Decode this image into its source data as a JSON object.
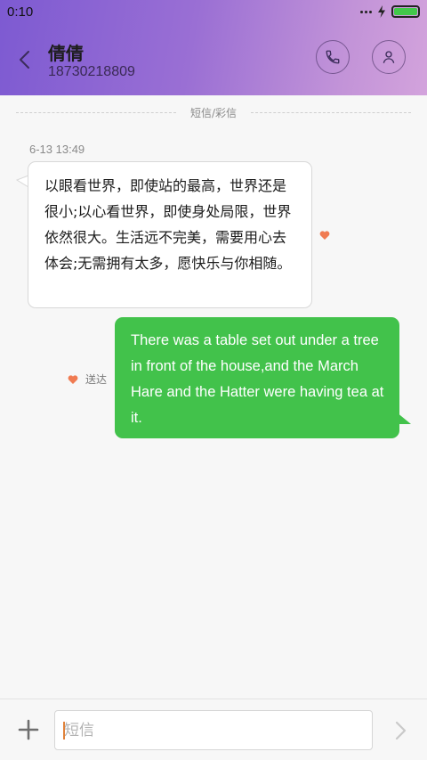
{
  "status_bar": {
    "time": "0:10"
  },
  "header": {
    "contact_name": "倩倩",
    "contact_number": "18730218809"
  },
  "thread": {
    "divider_label": "短信/彩信",
    "timestamp": "6-13 13:49",
    "incoming_message": "以眼看世界，即使站的最高，世界还是很小;以心看世界，即使身处局限，世界依然很大。生活远不完美，需要用心去体会;无需拥有太多，愿快乐与你相随。",
    "outgoing_message": "There was a table set out under a tree in front of the house,and the March Hare and the Hatter were having tea at it.",
    "delivery_status": "送达"
  },
  "composer": {
    "placeholder": "短信",
    "value": ""
  },
  "colors": {
    "header_gradient_start": "#7d5ad2",
    "header_gradient_end": "#d3a3dc",
    "outgoing_bubble": "#42c24b",
    "heart": "#f07b52",
    "battery": "#42c84a"
  },
  "icons": {
    "back": "chevron-left-icon",
    "call": "phone-icon",
    "profile": "person-icon",
    "attach": "plus-icon",
    "send": "chevron-right-icon",
    "status": "heart-icon"
  }
}
